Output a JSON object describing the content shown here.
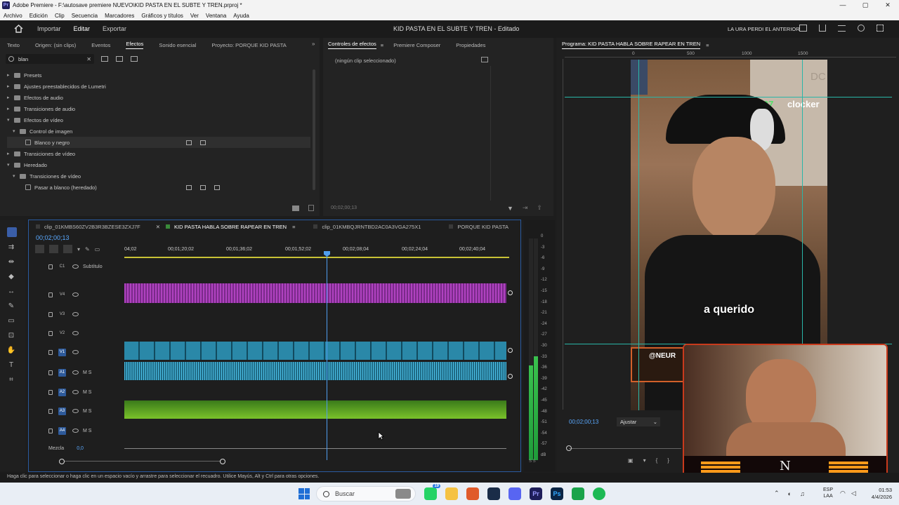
{
  "window": {
    "title": "Adobe Premiere - F:\\autosave premiere NUEVO\\KID PASTA EN EL SUBTE Y TREN.prproj *",
    "app_badge": "Pr",
    "controls": [
      "—",
      "▢",
      "✕"
    ]
  },
  "menu": [
    "Archivo",
    "Edición",
    "Clip",
    "Secuencia",
    "Marcadores",
    "Gráficos y títulos",
    "Ver",
    "Ventana",
    "Ayuda"
  ],
  "workspace": {
    "tabs": [
      "Importar",
      "Editar",
      "Exportar"
    ],
    "active_tab": "Editar",
    "project_title": "KID PASTA EN EL SUBTE Y TREN",
    "project_status": "- Editado",
    "right_label": "LA URA PERDI EL ANTERIOR"
  },
  "effects_panel": {
    "tabs": [
      "Texto",
      "Origen: (sin clips)",
      "Eventos",
      "Efectos",
      "Sonido esencial",
      "Proyecto: PORQUE KID PASTA"
    ],
    "active_tab": "Efectos",
    "search_value": "blan",
    "tree": [
      {
        "label": "Presets",
        "depth": 0,
        "open": false
      },
      {
        "label": "Ajustes preestablecidos de Lumetri",
        "depth": 0,
        "open": false
      },
      {
        "label": "Efectos de audio",
        "depth": 0,
        "open": false
      },
      {
        "label": "Transiciones de audio",
        "depth": 0,
        "open": false
      },
      {
        "label": "Efectos de vídeo",
        "depth": 0,
        "open": true
      },
      {
        "label": "Control de imagen",
        "depth": 1,
        "open": true
      },
      {
        "label": "Blanco y negro",
        "depth": 2,
        "leaf": true,
        "selected": true
      },
      {
        "label": "Transiciones de vídeo",
        "depth": 0,
        "open": false
      },
      {
        "label": "Heredado",
        "depth": 0,
        "open": true
      },
      {
        "label": "Transiciones de vídeo",
        "depth": 1,
        "open": true
      },
      {
        "label": "Pasar a blanco (heredado)",
        "depth": 2,
        "leaf": true
      }
    ]
  },
  "effect_controls": {
    "tabs": [
      "Controles de efectos",
      "Premiere Composer",
      "Propiedades"
    ],
    "active_tab": "Controles de efectos",
    "message": "(ningún clip seleccionado)",
    "timecode": "00;02;00;13"
  },
  "program_monitor": {
    "title": "Programa: KID PASTA HABLA SOBRE RAPEAR EN TREN",
    "ruler": [
      "0",
      "500",
      "1000",
      "1500"
    ],
    "timecode": "00;02;00;13",
    "fit": "Ajustar",
    "overlay_top_number": "1.07",
    "overlay_top_name": "clocker",
    "overlay_corner": "DC",
    "caption": "a querido",
    "cam_tag": "@NEUR",
    "logo": "N"
  },
  "timeline": {
    "tabs": [
      "clip_01KMBS60ZV2B3R3BZESE3ZXJ7F",
      "KID PASTA HABLA SOBRE RAPEAR EN TREN",
      "clip_01KMBQJRNTBD2AC0A3VGA275X1",
      "PORQUE KID PASTA"
    ],
    "active_tab": "KID PASTA HABLA SOBRE RAPEAR EN TREN",
    "timecode": "00;02;00;13",
    "ruler": [
      "04;02",
      "00;01;20;02",
      "00;01;36;02",
      "00;01;52;02",
      "00;02;08;04",
      "00;02;24;04",
      "00;02;40;04"
    ],
    "tracks": [
      {
        "id": "C1",
        "label": "Subtítulo"
      },
      {
        "id": "V4",
        "label": ""
      },
      {
        "id": "V3",
        "label": ""
      },
      {
        "id": "V2",
        "label": ""
      },
      {
        "id": "V1",
        "label": ""
      },
      {
        "id": "A1",
        "label": "M  S"
      },
      {
        "id": "A2",
        "label": "M  S"
      },
      {
        "id": "A3",
        "label": "M  S"
      },
      {
        "id": "A4",
        "label": "M  S"
      }
    ],
    "mix_label": "Mezcla",
    "mix_value": "0,0"
  },
  "meter": {
    "labels": [
      "0",
      "-3",
      "-6",
      "-9",
      "-12",
      "-15",
      "-18",
      "-21",
      "-24",
      "-27",
      "-30",
      "-33",
      "-36",
      "-39",
      "-42",
      "-45",
      "-48",
      "-51",
      "-54",
      "-57",
      "dB"
    ],
    "buttons": "S S",
    "level": 0.78
  },
  "status_bar": "Haga clic para seleccionar o haga clic en un espacio vacío y arrastre para seleccionar el recuadro. Utilice Mayús, Alt y Ctrl para otras opciones.",
  "taskbar": {
    "search_placeholder": "Buscar",
    "lang": "ESP",
    "lang2": "LAA",
    "time": "01:53",
    "date": "4/4/2026",
    "badge_count": "19"
  }
}
